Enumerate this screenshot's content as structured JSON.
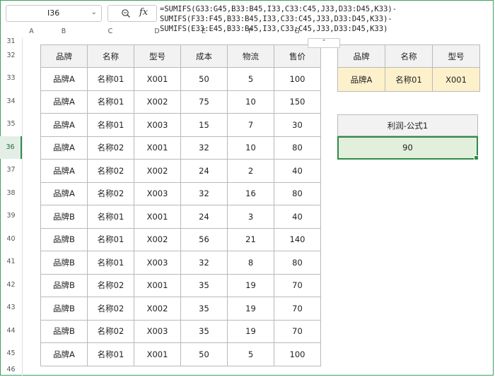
{
  "formula_bar": {
    "name_box": "I36",
    "fx_label": "fx",
    "formula_lines": [
      "=SUMIFS(G33:G45,B33:B45,I33,C33:C45,J33,D33:D45,K33)-",
      "SUMIFS(F33:F45,B33:B45,I33,C33:C45,J33,D33:D45,K33)-",
      "SUMIFS(E33:E45,B33:B45,I33,C33:C45,J33,D33:D45,K33)"
    ],
    "collapse_glyph": "˄"
  },
  "column_headers": [
    "A",
    "B",
    "C",
    "D",
    "E",
    "F",
    "G"
  ],
  "row_headers": [
    "31",
    "32",
    "33",
    "34",
    "35",
    "36",
    "37",
    "38",
    "39",
    "40",
    "41",
    "42",
    "43",
    "44",
    "45",
    "46"
  ],
  "active_row": "36",
  "main_table": {
    "headers": [
      "品牌",
      "名称",
      "型号",
      "成本",
      "物流",
      "售价"
    ],
    "rows": [
      [
        "品牌A",
        "名称01",
        "X001",
        "50",
        "5",
        "100"
      ],
      [
        "品牌A",
        "名称01",
        "X002",
        "75",
        "10",
        "150"
      ],
      [
        "品牌A",
        "名称01",
        "X003",
        "15",
        "7",
        "30"
      ],
      [
        "品牌A",
        "名称02",
        "X001",
        "32",
        "10",
        "80"
      ],
      [
        "品牌A",
        "名称02",
        "X002",
        "24",
        "2",
        "40"
      ],
      [
        "品牌A",
        "名称02",
        "X003",
        "32",
        "16",
        "80"
      ],
      [
        "品牌B",
        "名称01",
        "X001",
        "24",
        "3",
        "40"
      ],
      [
        "品牌B",
        "名称01",
        "X002",
        "56",
        "21",
        "140"
      ],
      [
        "品牌B",
        "名称01",
        "X003",
        "32",
        "8",
        "80"
      ],
      [
        "品牌B",
        "名称02",
        "X001",
        "35",
        "19",
        "70"
      ],
      [
        "品牌B",
        "名称02",
        "X002",
        "35",
        "19",
        "70"
      ],
      [
        "品牌B",
        "名称02",
        "X003",
        "35",
        "19",
        "70"
      ],
      [
        "品牌A",
        "名称01",
        "X001",
        "50",
        "5",
        "100"
      ]
    ]
  },
  "lookup_table": {
    "headers": [
      "品牌",
      "名称",
      "型号"
    ],
    "values": [
      "品牌A",
      "名称01",
      "X001"
    ]
  },
  "profit": {
    "label": "利润-公式1",
    "value": "90"
  },
  "colors": {
    "accent_green": "#2e8b4a",
    "header_fill": "#f2f2f2",
    "criteria_fill": "#fdf1cc",
    "result_fill": "#e2efda"
  }
}
